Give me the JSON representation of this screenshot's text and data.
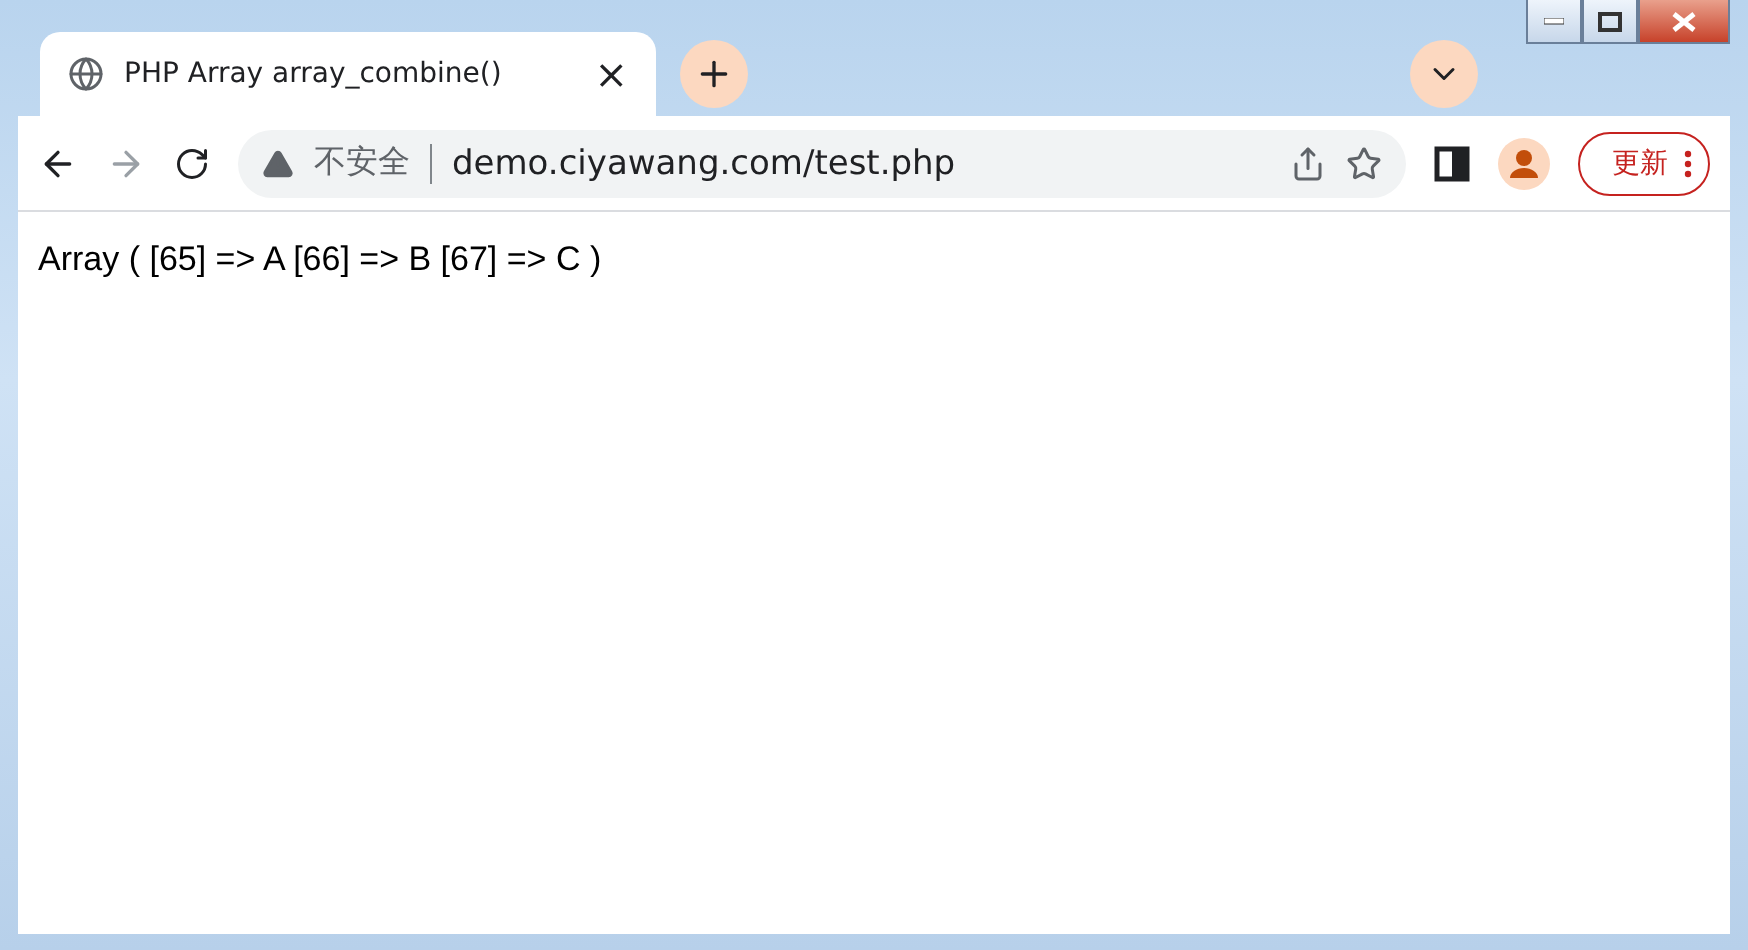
{
  "tab": {
    "title": "PHP Array array_combine()",
    "close": "×"
  },
  "toolbar": {
    "security": "不安全",
    "url": "demo.ciyawang.com/test.php",
    "update": "更新"
  },
  "page": {
    "text": "Array ( [65] => A [66] => B [67] => C )"
  }
}
